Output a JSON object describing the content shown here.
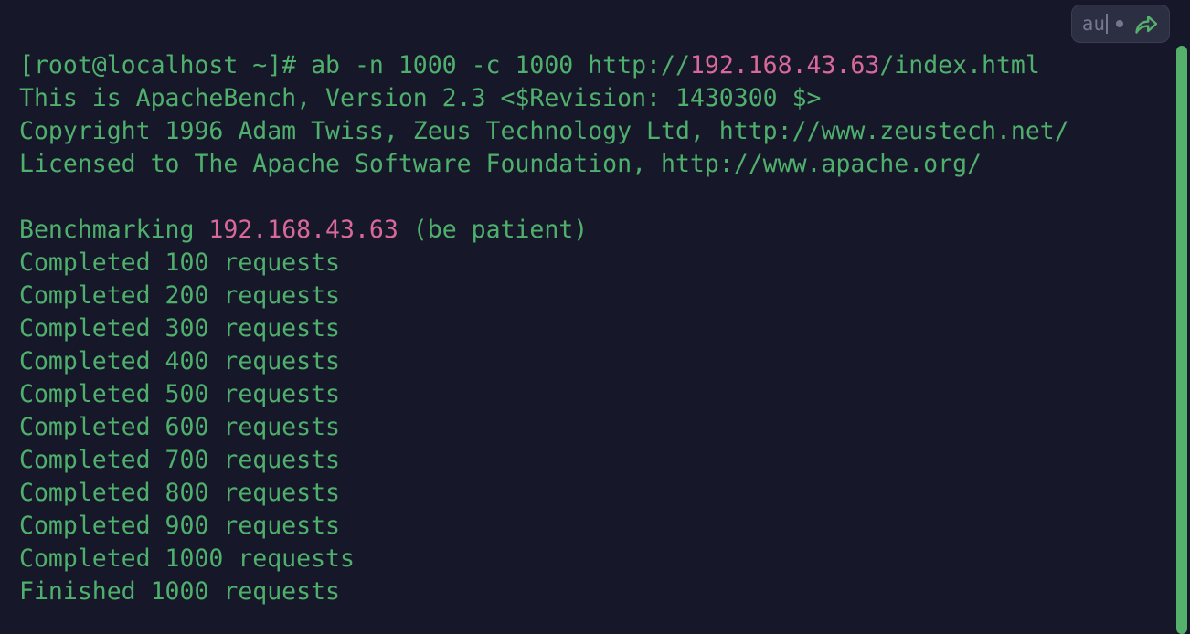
{
  "terminal": {
    "background_color": "#161728",
    "text_color": "#4fb06d",
    "highlight_color": "#d8699a",
    "lines": [
      {
        "segments": [
          {
            "text": "[root@localhost ~]# ab -n 1000 -c 1000 http://",
            "color": "green"
          },
          {
            "text": "192.168.43.63",
            "color": "pink"
          },
          {
            "text": "/index.html",
            "color": "green"
          }
        ]
      },
      {
        "segments": [
          {
            "text": "This is ApacheBench, Version 2.3 <$Revision: 1430300 $>",
            "color": "green"
          }
        ]
      },
      {
        "segments": [
          {
            "text": "Copyright 1996 Adam Twiss, Zeus Technology Ltd, http://www.zeustech.net/",
            "color": "green"
          }
        ]
      },
      {
        "segments": [
          {
            "text": "Licensed to The Apache Software Foundation, http://www.apache.org/",
            "color": "green"
          }
        ]
      },
      {
        "segments": [
          {
            "text": "",
            "color": "green"
          }
        ]
      },
      {
        "segments": [
          {
            "text": "Benchmarking ",
            "color": "green"
          },
          {
            "text": "192.168.43.63",
            "color": "pink"
          },
          {
            "text": " (be patient)",
            "color": "green"
          }
        ]
      },
      {
        "segments": [
          {
            "text": "Completed 100 requests",
            "color": "green"
          }
        ]
      },
      {
        "segments": [
          {
            "text": "Completed 200 requests",
            "color": "green"
          }
        ]
      },
      {
        "segments": [
          {
            "text": "Completed 300 requests",
            "color": "green"
          }
        ]
      },
      {
        "segments": [
          {
            "text": "Completed 400 requests",
            "color": "green"
          }
        ]
      },
      {
        "segments": [
          {
            "text": "Completed 500 requests",
            "color": "green"
          }
        ]
      },
      {
        "segments": [
          {
            "text": "Completed 600 requests",
            "color": "green"
          }
        ]
      },
      {
        "segments": [
          {
            "text": "Completed 700 requests",
            "color": "green"
          }
        ]
      },
      {
        "segments": [
          {
            "text": "Completed 800 requests",
            "color": "green"
          }
        ]
      },
      {
        "segments": [
          {
            "text": "Completed 900 requests",
            "color": "green"
          }
        ]
      },
      {
        "segments": [
          {
            "text": "Completed 1000 requests",
            "color": "green"
          }
        ]
      },
      {
        "segments": [
          {
            "text": "Finished 1000 requests",
            "color": "green"
          }
        ]
      }
    ]
  },
  "badge": {
    "input_value": "au",
    "dot_label": "•",
    "share_icon_name": "share-arrow-icon",
    "share_icon_color": "#55b06c",
    "background_color": "#2c2e42",
    "text_color": "#73778f"
  },
  "scrollbar": {
    "thumb_color": "#55b06c",
    "track_color": "#161728",
    "position_label": "top"
  }
}
